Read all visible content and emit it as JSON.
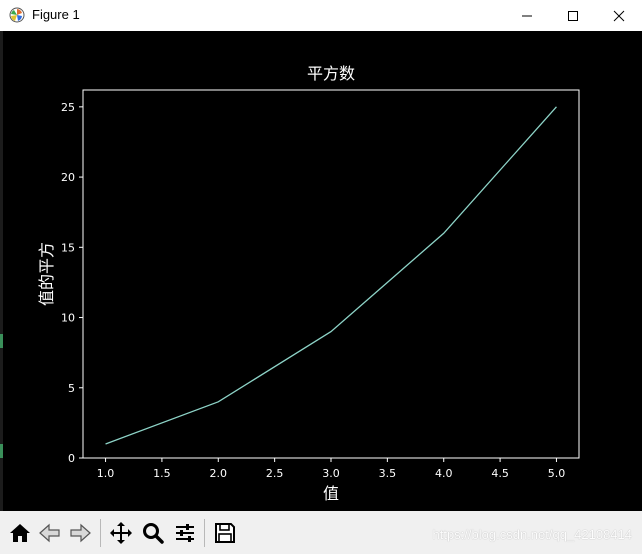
{
  "window": {
    "title": "Figure 1",
    "app_icon": "matplotlib-icon",
    "controls": [
      "minimize-icon",
      "maximize-icon",
      "close-icon"
    ]
  },
  "toolbar": {
    "buttons": [
      {
        "name": "home-icon"
      },
      {
        "name": "back-icon"
      },
      {
        "name": "forward-icon"
      },
      {
        "name": "pan-icon"
      },
      {
        "name": "zoom-icon"
      },
      {
        "name": "configure-subplots-icon"
      },
      {
        "name": "save-icon"
      }
    ]
  },
  "watermark": "https://blog.csdn.net/qq_42108414",
  "colors": {
    "background": "#000000",
    "axes": "#ffffff",
    "line": "#8dd3c7"
  },
  "chart_data": {
    "type": "line",
    "title": "平方数",
    "xlabel": "值",
    "ylabel": "值的平方",
    "x": [
      1,
      2,
      3,
      4,
      5
    ],
    "series": [
      {
        "values": [
          1,
          4,
          9,
          16,
          25
        ]
      }
    ],
    "xlim": [
      0.8,
      5.2
    ],
    "ylim": [
      0,
      26.2
    ],
    "xticks": [
      "1.0",
      "1.5",
      "2.0",
      "2.5",
      "3.0",
      "3.5",
      "4.0",
      "4.5",
      "5.0"
    ],
    "yticks": [
      "0",
      "5",
      "10",
      "15",
      "20",
      "25"
    ],
    "grid": false
  }
}
